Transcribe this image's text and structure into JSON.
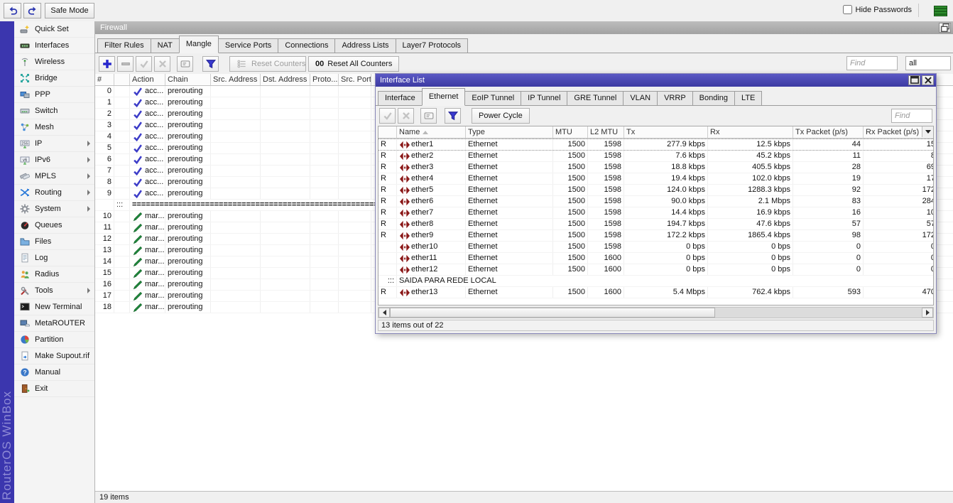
{
  "brand": "RouterOS WinBox",
  "topbar": {
    "safe_mode": "Safe Mode",
    "hide_passwords": "Hide Passwords"
  },
  "sidebar": {
    "items": [
      {
        "label": "Quick Set",
        "icon": "quick-set-icon",
        "submenu": false
      },
      {
        "label": "Interfaces",
        "icon": "interfaces-icon",
        "submenu": false
      },
      {
        "label": "Wireless",
        "icon": "wireless-icon",
        "submenu": false
      },
      {
        "label": "Bridge",
        "icon": "bridge-icon",
        "submenu": false
      },
      {
        "label": "PPP",
        "icon": "ppp-icon",
        "submenu": false
      },
      {
        "label": "Switch",
        "icon": "switch-icon",
        "submenu": false
      },
      {
        "label": "Mesh",
        "icon": "mesh-icon",
        "submenu": false
      },
      {
        "label": "IP",
        "icon": "ip-icon",
        "submenu": true
      },
      {
        "label": "IPv6",
        "icon": "ipv6-icon",
        "submenu": true
      },
      {
        "label": "MPLS",
        "icon": "mpls-icon",
        "submenu": true
      },
      {
        "label": "Routing",
        "icon": "routing-icon",
        "submenu": true
      },
      {
        "label": "System",
        "icon": "system-icon",
        "submenu": true
      },
      {
        "label": "Queues",
        "icon": "queues-icon",
        "submenu": false
      },
      {
        "label": "Files",
        "icon": "files-icon",
        "submenu": false
      },
      {
        "label": "Log",
        "icon": "log-icon",
        "submenu": false
      },
      {
        "label": "Radius",
        "icon": "radius-icon",
        "submenu": false
      },
      {
        "label": "Tools",
        "icon": "tools-icon",
        "submenu": true
      },
      {
        "label": "New Terminal",
        "icon": "terminal-icon",
        "submenu": false
      },
      {
        "label": "MetaROUTER",
        "icon": "metarouter-icon",
        "submenu": false
      },
      {
        "label": "Partition",
        "icon": "partition-icon",
        "submenu": false
      },
      {
        "label": "Make Supout.rif",
        "icon": "supout-icon",
        "submenu": false
      },
      {
        "label": "Manual",
        "icon": "manual-icon",
        "submenu": false
      },
      {
        "label": "Exit",
        "icon": "exit-icon",
        "submenu": false
      }
    ]
  },
  "firewall": {
    "title": "Firewall",
    "tabs": [
      {
        "label": "Filter Rules",
        "active": false
      },
      {
        "label": "NAT",
        "active": false
      },
      {
        "label": "Mangle",
        "active": true
      },
      {
        "label": "Service Ports",
        "active": false
      },
      {
        "label": "Connections",
        "active": false
      },
      {
        "label": "Address Lists",
        "active": false
      },
      {
        "label": "Layer7 Protocols",
        "active": false
      }
    ],
    "toolbar": {
      "reset_counters": "Reset Counters",
      "reset_all_prefix": "00",
      "reset_all": "Reset All Counters",
      "find_placeholder": "Find",
      "filter_value": "all"
    },
    "columns": [
      "#",
      "",
      "Action",
      "Chain",
      "Src. Address",
      "Dst. Address",
      "Proto...",
      "Src. Port"
    ],
    "rows": [
      {
        "num": "0",
        "icon": "accept-icon",
        "action": "acc...",
        "chain": "prerouting"
      },
      {
        "num": "1",
        "icon": "accept-icon",
        "action": "acc...",
        "chain": "prerouting"
      },
      {
        "num": "2",
        "icon": "accept-icon",
        "action": "acc...",
        "chain": "prerouting"
      },
      {
        "num": "3",
        "icon": "accept-icon",
        "action": "acc...",
        "chain": "prerouting"
      },
      {
        "num": "4",
        "icon": "accept-icon",
        "action": "acc...",
        "chain": "prerouting"
      },
      {
        "num": "5",
        "icon": "accept-icon",
        "action": "acc...",
        "chain": "prerouting"
      },
      {
        "num": "6",
        "icon": "accept-icon",
        "action": "acc...",
        "chain": "prerouting"
      },
      {
        "num": "7",
        "icon": "accept-icon",
        "action": "acc...",
        "chain": "prerouting"
      },
      {
        "num": "8",
        "icon": "accept-icon",
        "action": "acc...",
        "chain": "prerouting"
      },
      {
        "num": "9",
        "icon": "accept-icon",
        "action": "acc...",
        "chain": "prerouting"
      },
      {
        "separator": true,
        "marker": ":::",
        "line": "=============================================================="
      },
      {
        "num": "10",
        "icon": "mark-icon",
        "action": "mar...",
        "chain": "prerouting"
      },
      {
        "num": "11",
        "icon": "mark-icon",
        "action": "mar...",
        "chain": "prerouting"
      },
      {
        "num": "12",
        "icon": "mark-icon",
        "action": "mar...",
        "chain": "prerouting"
      },
      {
        "num": "13",
        "icon": "mark-icon",
        "action": "mar...",
        "chain": "prerouting"
      },
      {
        "num": "14",
        "icon": "mark-icon",
        "action": "mar...",
        "chain": "prerouting"
      },
      {
        "num": "15",
        "icon": "mark-icon",
        "action": "mar...",
        "chain": "prerouting"
      },
      {
        "num": "16",
        "icon": "mark-icon",
        "action": "mar...",
        "chain": "prerouting"
      },
      {
        "num": "17",
        "icon": "mark-icon",
        "action": "mar...",
        "chain": "prerouting"
      },
      {
        "num": "18",
        "icon": "mark-icon",
        "action": "mar...",
        "chain": "prerouting"
      }
    ],
    "status": "19 items"
  },
  "interface_list": {
    "title": "Interface List",
    "tabs": [
      {
        "label": "Interface",
        "active": false
      },
      {
        "label": "Ethernet",
        "active": true
      },
      {
        "label": "EoIP Tunnel",
        "active": false
      },
      {
        "label": "IP Tunnel",
        "active": false
      },
      {
        "label": "GRE Tunnel",
        "active": false
      },
      {
        "label": "VLAN",
        "active": false
      },
      {
        "label": "VRRP",
        "active": false
      },
      {
        "label": "Bonding",
        "active": false
      },
      {
        "label": "LTE",
        "active": false
      }
    ],
    "toolbar": {
      "power_cycle": "Power Cycle",
      "find_placeholder": "Find"
    },
    "columns": [
      "",
      "Name",
      "Type",
      "MTU",
      "L2 MTU",
      "Tx",
      "Rx",
      "Tx Packet (p/s)",
      "Rx Packet (p/s)"
    ],
    "rows": [
      {
        "flag": "R",
        "name": "ether1",
        "type": "Ethernet",
        "mtu": "1500",
        "l2mtu": "1598",
        "tx": "277.9 kbps",
        "rx": "12.5 kbps",
        "txp": "44",
        "rxp": "15",
        "focused": true
      },
      {
        "flag": "R",
        "name": "ether2",
        "type": "Ethernet",
        "mtu": "1500",
        "l2mtu": "1598",
        "tx": "7.6 kbps",
        "rx": "45.2 kbps",
        "txp": "11",
        "rxp": "8"
      },
      {
        "flag": "R",
        "name": "ether3",
        "type": "Ethernet",
        "mtu": "1500",
        "l2mtu": "1598",
        "tx": "18.8 kbps",
        "rx": "405.5 kbps",
        "txp": "28",
        "rxp": "69"
      },
      {
        "flag": "R",
        "name": "ether4",
        "type": "Ethernet",
        "mtu": "1500",
        "l2mtu": "1598",
        "tx": "19.4 kbps",
        "rx": "102.0 kbps",
        "txp": "19",
        "rxp": "17"
      },
      {
        "flag": "R",
        "name": "ether5",
        "type": "Ethernet",
        "mtu": "1500",
        "l2mtu": "1598",
        "tx": "124.0 kbps",
        "rx": "1288.3 kbps",
        "txp": "92",
        "rxp": "172"
      },
      {
        "flag": "R",
        "name": "ether6",
        "type": "Ethernet",
        "mtu": "1500",
        "l2mtu": "1598",
        "tx": "90.0 kbps",
        "rx": "2.1 Mbps",
        "txp": "83",
        "rxp": "284"
      },
      {
        "flag": "R",
        "name": "ether7",
        "type": "Ethernet",
        "mtu": "1500",
        "l2mtu": "1598",
        "tx": "14.4 kbps",
        "rx": "16.9 kbps",
        "txp": "16",
        "rxp": "10"
      },
      {
        "flag": "R",
        "name": "ether8",
        "type": "Ethernet",
        "mtu": "1500",
        "l2mtu": "1598",
        "tx": "194.7 kbps",
        "rx": "47.6 kbps",
        "txp": "57",
        "rxp": "57"
      },
      {
        "flag": "R",
        "name": "ether9",
        "type": "Ethernet",
        "mtu": "1500",
        "l2mtu": "1598",
        "tx": "172.2 kbps",
        "rx": "1865.4 kbps",
        "txp": "98",
        "rxp": "172"
      },
      {
        "flag": "",
        "name": "ether10",
        "type": "Ethernet",
        "mtu": "1500",
        "l2mtu": "1598",
        "tx": "0 bps",
        "rx": "0 bps",
        "txp": "0",
        "rxp": "0"
      },
      {
        "flag": "",
        "name": "ether11",
        "type": "Ethernet",
        "mtu": "1500",
        "l2mtu": "1600",
        "tx": "0 bps",
        "rx": "0 bps",
        "txp": "0",
        "rxp": "0"
      },
      {
        "flag": "",
        "name": "ether12",
        "type": "Ethernet",
        "mtu": "1500",
        "l2mtu": "1600",
        "tx": "0 bps",
        "rx": "0 bps",
        "txp": "0",
        "rxp": "0"
      },
      {
        "comment": true,
        "marker": ":::",
        "text": "SAIDA PARA REDE LOCAL"
      },
      {
        "flag": "R",
        "name": "ether13",
        "type": "Ethernet",
        "mtu": "1500",
        "l2mtu": "1600",
        "tx": "5.4 Mbps",
        "rx": "762.4 kbps",
        "txp": "593",
        "rxp": "470"
      }
    ],
    "status": "13 items out of 22"
  },
  "colors": {
    "accent": "#3b36ae",
    "active_titlebar": "#4341ab",
    "inactive_titlebar": "#ababab",
    "green_indicator": "#2f8f2f"
  }
}
